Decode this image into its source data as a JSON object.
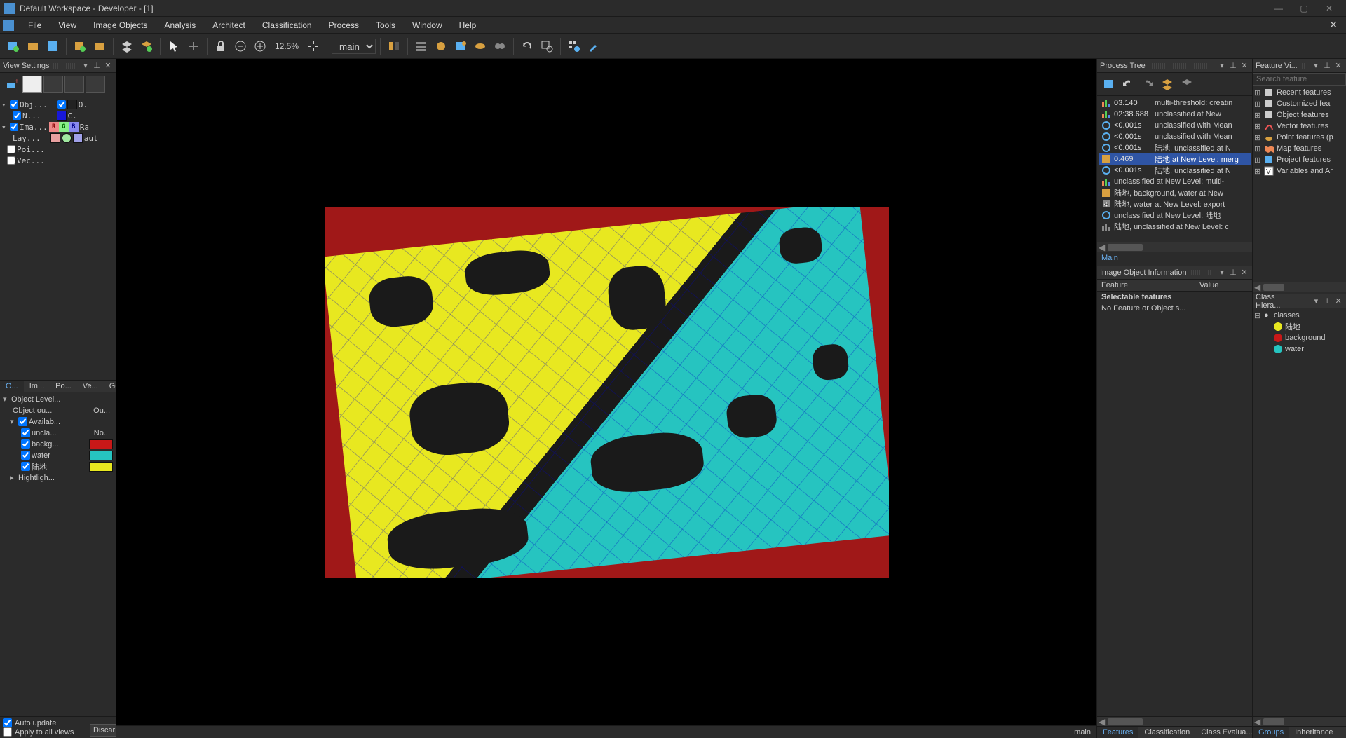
{
  "title": "Default Workspace - Developer - [1]",
  "menu": [
    "File",
    "View",
    "Image Objects",
    "Analysis",
    "Architect",
    "Classification",
    "Process",
    "Tools",
    "Window",
    "Help"
  ],
  "toolbar": {
    "zoom": "12.5%",
    "map_select": "main"
  },
  "view_settings": {
    "title": "View Settings",
    "layers_header_1": "Obj...",
    "layers_header_2": "O.",
    "row_n": "N...",
    "row_c": "C.",
    "row_ima": "Ima...",
    "row_ra": "Ra",
    "row_lay": "Lay...",
    "row_aut": "aut",
    "row_poi": "Poi...",
    "row_vec": "Vec..."
  },
  "left_tabs": [
    "O...",
    "Im...",
    "Po...",
    "Ve...",
    "Ge..."
  ],
  "object_level": {
    "title": "Object Level...",
    "rows": [
      {
        "ind": 12,
        "label": "Object ou...",
        "extra": "Ou..."
      },
      {
        "ind": 8,
        "toggle": "▾",
        "check": true,
        "label": "Availab..."
      },
      {
        "ind": 24,
        "check": true,
        "label": "uncla...",
        "extra": "No..."
      },
      {
        "ind": 24,
        "check": true,
        "label": "backg...",
        "color": "#c81818"
      },
      {
        "ind": 24,
        "check": true,
        "label": "water",
        "color": "#26c4c0"
      },
      {
        "ind": 24,
        "check": true,
        "label": "陆地",
        "color": "#e8e820"
      },
      {
        "ind": 8,
        "toggle": "▸",
        "label": "Hightligh..."
      }
    ]
  },
  "auto_update": "Auto update",
  "apply_all": "Apply to all views",
  "discard": "Discar",
  "status_main": "main",
  "process_tree": {
    "title": "Process Tree",
    "rows": [
      {
        "icon": "bar",
        "time": "03.140",
        "text": "multi-threshold: creatin"
      },
      {
        "icon": "bar",
        "time": "02:38.688",
        "text": "unclassified at  New "
      },
      {
        "icon": "circ",
        "time": "<0.001s",
        "text": "unclassified with Mean"
      },
      {
        "icon": "circ",
        "time": "<0.001s",
        "text": "unclassified with Mean"
      },
      {
        "icon": "circ",
        "time": "<0.001s",
        "text": "陆地, unclassified at  N"
      },
      {
        "icon": "land",
        "time": "0.469",
        "text": "陆地 at  New Level: merg",
        "selected": true
      },
      {
        "icon": "circ",
        "time": "<0.001s",
        "text": "陆地, unclassified at  N"
      },
      {
        "icon": "bar",
        "text": "unclassified at  New Level: multi-"
      },
      {
        "icon": "land",
        "text": "陆地, background, water at  New"
      },
      {
        "icon": "exp",
        "text": "陆地, water at  New Level: export"
      },
      {
        "icon": "circ",
        "text": "unclassified at  New Level: 陆地"
      },
      {
        "icon": "ld2",
        "text": "陆地, unclassified at  New Level: c"
      }
    ],
    "sub_tab": "Main"
  },
  "ioi": {
    "title": "Image Object Information",
    "col1": "Feature",
    "col2": "Value",
    "bold": "Selectable features",
    "text": "No Feature or Object s..."
  },
  "ioi_tabs": [
    "Features",
    "Classification",
    "Class Evalua..."
  ],
  "feature_view": {
    "title": "Feature Vi...",
    "search_placeholder": "Search feature",
    "items": [
      {
        "icon": "sq",
        "label": "Recent features"
      },
      {
        "icon": "sq",
        "label": "Customized fea"
      },
      {
        "icon": "sq",
        "label": "Object features"
      },
      {
        "icon": "vec",
        "label": "Vector features"
      },
      {
        "icon": "pt",
        "label": "Point features (p"
      },
      {
        "icon": "map",
        "label": "Map features"
      },
      {
        "icon": "prj",
        "label": "Project features"
      },
      {
        "icon": "var",
        "label": "Variables and Ar"
      }
    ]
  },
  "class_hier": {
    "title": "Class Hiera...",
    "root": "classes",
    "classes": [
      {
        "color": "#e8e820",
        "label": "陆地"
      },
      {
        "color": "#c81818",
        "label": "background"
      },
      {
        "color": "#26c4c0",
        "label": "water"
      }
    ]
  },
  "class_tabs": [
    "Groups",
    "Inheritance"
  ]
}
